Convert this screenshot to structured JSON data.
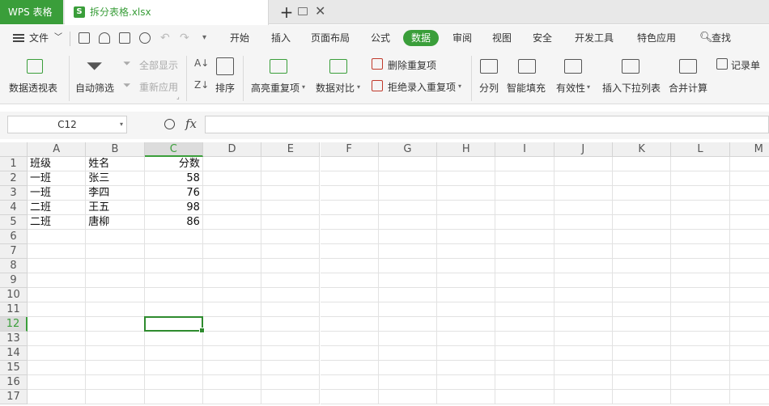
{
  "app": {
    "name": "WPS 表格"
  },
  "file_tab": {
    "filename": "拆分表格.xlsx",
    "icon_letter": "S"
  },
  "menu": {
    "file_label": "文件",
    "tabs": [
      "开始",
      "插入",
      "页面布局",
      "公式",
      "数据",
      "审阅",
      "视图",
      "安全",
      "开发工具",
      "特色应用"
    ],
    "active_tab": "数据",
    "search_label": "查找"
  },
  "ribbon": {
    "pivot_table": "数据透视表",
    "auto_filter": "自动筛选",
    "show_all": "全部显示",
    "reapply": "重新应用",
    "sort": "排序",
    "highlight_duplicates": "高亮重复项",
    "data_compare": "数据对比",
    "remove_duplicates": "删除重复项",
    "reject_duplicates": "拒绝录入重复项",
    "split_column": "分列",
    "smart_fill": "智能填充",
    "validity": "有效性",
    "insert_dropdown": "插入下拉列表",
    "consolidate": "合并计算",
    "record_form": "记录单"
  },
  "formula_bar": {
    "name_box": "C12",
    "fx_label": "fx",
    "formula": ""
  },
  "sheet": {
    "columns": [
      "A",
      "B",
      "C",
      "D",
      "E",
      "F",
      "G",
      "H",
      "I",
      "J",
      "K",
      "L",
      "M"
    ],
    "row_numbers": [
      "1",
      "2",
      "3",
      "4",
      "5",
      "6",
      "7",
      "8",
      "9",
      "10",
      "11",
      "12",
      "13",
      "14",
      "15",
      "16",
      "17"
    ],
    "selected_column": "C",
    "selected_row": "12",
    "cells": {
      "A1": "班级",
      "B1": "姓名",
      "C1": "分数",
      "A2": "一班",
      "B2": "张三",
      "C2": "58",
      "A3": "一班",
      "B3": "李四",
      "C3": "76",
      "A4": "二班",
      "B4": "王五",
      "C4": "98",
      "A5": "二班",
      "B5": "唐柳",
      "C5": "86"
    },
    "numeric_columns": [
      "C"
    ]
  },
  "colors": {
    "brand": "#3a9e3a",
    "selection": "#2e8b2e"
  }
}
